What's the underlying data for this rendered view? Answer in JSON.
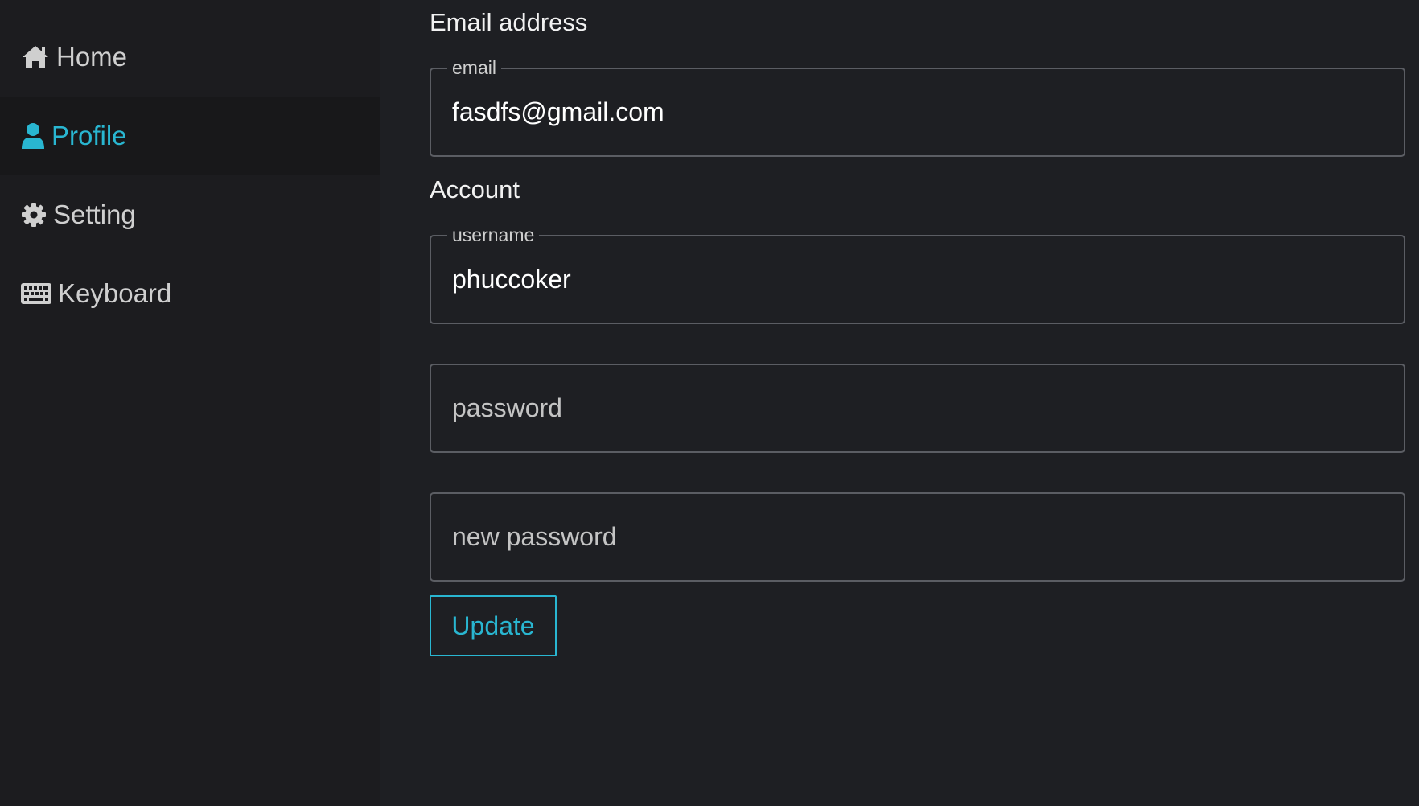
{
  "sidebar": {
    "items": [
      {
        "label": "Home",
        "icon": "home-icon",
        "active": false
      },
      {
        "label": "Profile",
        "icon": "user-icon",
        "active": true
      },
      {
        "label": "Setting",
        "icon": "gear-icon",
        "active": false
      },
      {
        "label": "Keyboard",
        "icon": "keyboard-icon",
        "active": false
      }
    ]
  },
  "main": {
    "email_section_title": "Email address",
    "email": {
      "legend": "email",
      "value": "fasdfs@gmail.com"
    },
    "account_section_title": "Account",
    "username": {
      "legend": "username",
      "value": "phuccoker"
    },
    "password": {
      "placeholder": "password"
    },
    "new_password": {
      "placeholder": "new password"
    },
    "update_label": "Update"
  },
  "colors": {
    "accent": "#29b6d1",
    "background": "#1e1f23",
    "sidebar": "#1c1c1f",
    "active_item_bg": "#18181a",
    "border": "#5b5d63"
  }
}
